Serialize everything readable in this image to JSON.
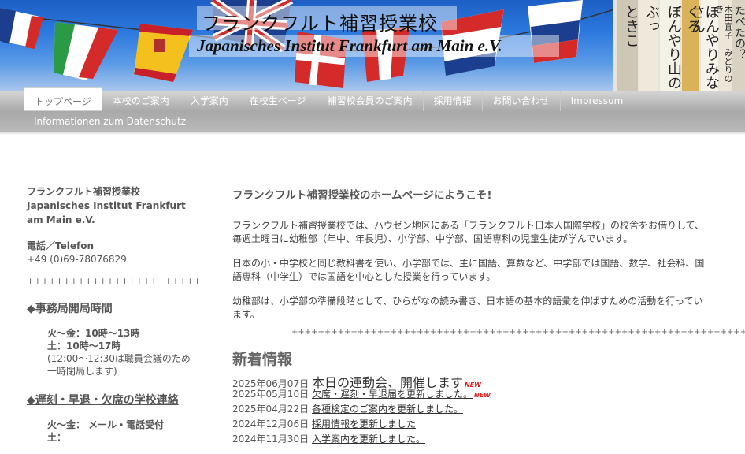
{
  "header": {
    "title_ja": "フランクフルト補習授業校",
    "title_de": "Japanisches Institut Frankfurt am Main e.V.",
    "book_spines": [
      "たべたの？",
      "木田宜子　みどりのき",
      "ぼんやりみなさん",
      "くろ",
      "ぼんやり山の",
      "ぶっ",
      "ときこ"
    ]
  },
  "nav": {
    "row1": [
      "トップページ",
      "本校のご案内",
      "入学案内",
      "在校生ページ",
      "補習校会員のご案内",
      "採用情報",
      "お問い合わせ",
      "Impressum"
    ],
    "row2": [
      "Informationen zum Datenschutz"
    ]
  },
  "sidebar": {
    "name_ja": "フランクフルト補習授業校",
    "name_de": "Japanisches Institut Frankfurt am Main e.V.",
    "tel_label": "電話／Telefon",
    "tel": "+49 (0)69-78076829",
    "separator": "++++++++++++++++++++++++",
    "office_hours_heading": "◆事務局開局時間",
    "office_hours": [
      "火〜金：10時〜13時",
      "土：10時〜17時"
    ],
    "office_hours_note": "(12:00〜12:30は職員会議のため一時閉局します)",
    "absence_heading": "◆遅刻・早退・欠席の学校連絡",
    "absence_lines": [
      "火〜金： メール・電話受付",
      "土："
    ]
  },
  "main": {
    "welcome": "フランクフルト補習授業校のホームページにようこそ!",
    "paragraphs": [
      "フランクフルト補習授業校では、ハウゼン地区にある「フランクフルト日本人国際学校」の校舎をお借りして、毎週土曜日に幼稚部（年中、年長児）、小学部、中学部、国語専科の児童生徒が学んでいます。",
      "日本の小・中学校と同じ教科書を使い、小学部では、主に国語、算数など、中学部では国語、数学、社会科、国語専科（中学生）では国語を中心とした授業を行っています。",
      "幼稚部は、小学部の準備段階として、ひらがなの読み書き、日本語の基本的語彙を伸ばすための活動を行っています。"
    ],
    "separator": "+++++++++++++++++++++++++++++++++++++++++++++++++++++++++++++++++++++",
    "news_heading": "新着情報",
    "news": [
      {
        "date": "2025年06月07日",
        "text": "本日の運動会、開催します",
        "badge": "NEW"
      },
      {
        "date": "2025年05月10日",
        "text": "欠席・遅刻・早退届を更新しました。",
        "badge": "NEW"
      },
      {
        "date": "2025年04月22日",
        "text": "各種検定のご案内を更新しました。",
        "badge": ""
      },
      {
        "date": "2024年12月06日",
        "text": "採用情報を更新しました",
        "badge": ""
      },
      {
        "date": "2024年11月30日",
        "text": "入学案内を更新しました。",
        "badge": ""
      }
    ]
  }
}
